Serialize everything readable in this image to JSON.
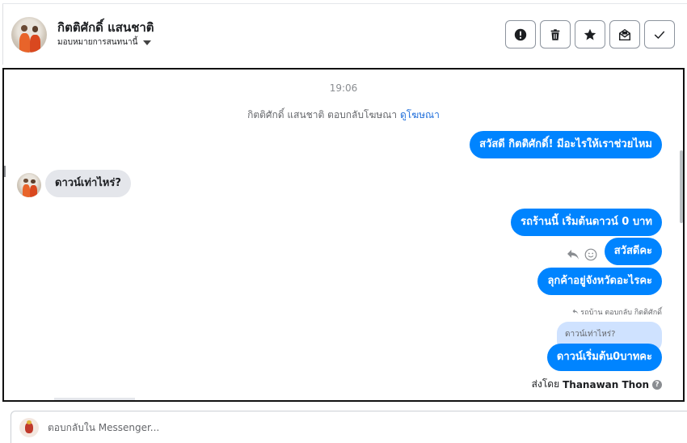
{
  "header": {
    "contact_name": "กิตติศักดิ์ แสนชาติ",
    "assign_label": "มอบหมายการสนทนานี้",
    "actions": [
      {
        "name": "report-spam-button",
        "icon": "alert-circle-icon"
      },
      {
        "name": "delete-button",
        "icon": "trash-icon"
      },
      {
        "name": "star-button",
        "icon": "star-icon"
      },
      {
        "name": "mark-unread-button",
        "icon": "mail-open-icon"
      },
      {
        "name": "mark-done-button",
        "icon": "check-icon"
      }
    ]
  },
  "conversation": {
    "timestamp": "19:06",
    "ad_reply_text": "กิตติศักดิ์ แสนชาติ ตอบกลับโฆษณา",
    "ad_reply_link": "ดูโฆษณา",
    "messages": [
      {
        "direction": "out",
        "text": "สวัสดี กิตติศักดิ์! มีอะไรให้เราช่วยไหม"
      },
      {
        "direction": "in",
        "text": "ดาวน์เท่าไหร่?"
      },
      {
        "direction": "out",
        "text": "รถร้านนี้ เริ่มต้นดาวน์ 0 บาท"
      },
      {
        "direction": "out",
        "text": "สวัสดีคะ"
      },
      {
        "direction": "out",
        "text": "ลุกค้าอยู่จังหวัดอะไรคะ"
      },
      {
        "direction": "out",
        "text": "ดาวน์เริ่มต้น0บาทคะ"
      }
    ],
    "reply_meta": "รถบ้าน ตอบกลับ กิตติศักดิ์",
    "quoted_text": "ดาวน์เท่าไหร่?",
    "sent_by_label": "ส่งโดย",
    "sent_by_name": "Thanawan Thon"
  },
  "composer": {
    "placeholder": "ตอบกลับใน Messenger..."
  },
  "colors": {
    "outgoing_bubble": "#0084ff",
    "incoming_bubble": "#e4e6eb",
    "quoted_bubble": "#cfe2ff",
    "link": "#216fdb"
  }
}
